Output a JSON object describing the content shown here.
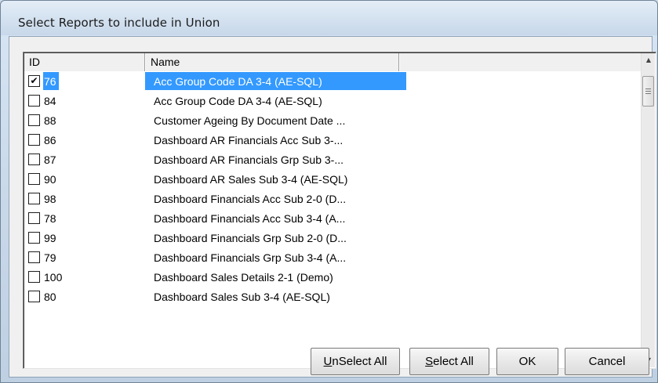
{
  "window": {
    "title": "Select Reports to include in Union"
  },
  "list": {
    "columns": {
      "id": "ID",
      "name": "Name"
    },
    "rows": [
      {
        "checked": true,
        "id": "76",
        "name": "Acc Group Code DA 3-4 (AE-SQL)",
        "selected": true
      },
      {
        "checked": false,
        "id": "84",
        "name": "Acc Group Code DA 3-4 (AE-SQL)"
      },
      {
        "checked": false,
        "id": "88",
        "name": "Customer Ageing By Document Date ..."
      },
      {
        "checked": false,
        "id": "86",
        "name": "Dashboard  AR Financials Acc Sub 3-..."
      },
      {
        "checked": false,
        "id": "87",
        "name": "Dashboard AR Financials Grp Sub 3-..."
      },
      {
        "checked": false,
        "id": "90",
        "name": "Dashboard AR Sales Sub 3-4 (AE-SQL)"
      },
      {
        "checked": false,
        "id": "98",
        "name": "Dashboard Financials Acc Sub 2-0 (D..."
      },
      {
        "checked": false,
        "id": "78",
        "name": "Dashboard Financials Acc Sub 3-4 (A..."
      },
      {
        "checked": false,
        "id": "99",
        "name": "Dashboard Financials Grp Sub 2-0 (D..."
      },
      {
        "checked": false,
        "id": "79",
        "name": "Dashboard Financials Grp Sub 3-4 (A..."
      },
      {
        "checked": false,
        "id": "100",
        "name": "Dashboard Sales Details 2-1 (Demo)"
      },
      {
        "checked": false,
        "id": "80",
        "name": "Dashboard Sales Sub 3-4 (AE-SQL)"
      }
    ],
    "checkmark": "✔"
  },
  "buttons": {
    "unselect_all": {
      "accel": "U",
      "rest": "nSelect All"
    },
    "select_all": {
      "accel": "S",
      "rest": "elect All"
    },
    "ok": "OK",
    "cancel": "Cancel"
  },
  "icons": {
    "scroll_up": "up-arrow-icon",
    "scroll_down": "down-arrow-icon"
  },
  "colors": {
    "selection": "#3399ff"
  }
}
